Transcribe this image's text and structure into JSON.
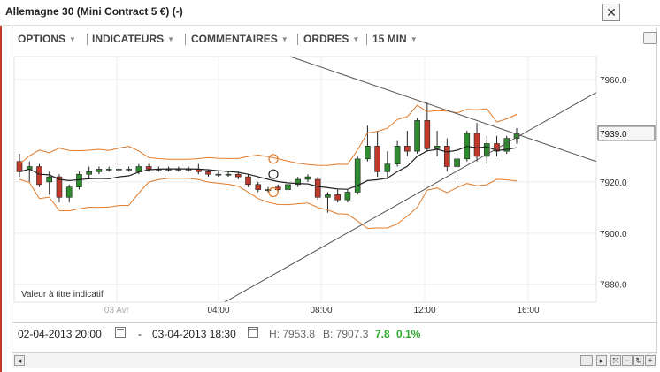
{
  "window": {
    "title": "Allemagne 30 (Mini Contract 5 €) (-)",
    "close_label": "✕"
  },
  "toolbar": {
    "items": [
      {
        "label": "OPTIONS"
      },
      {
        "label": "INDICATEURS"
      },
      {
        "label": "COMMENTAIRES"
      },
      {
        "label": "ORDRES"
      },
      {
        "label": "15 MIN"
      }
    ]
  },
  "chart": {
    "watermark": "Valeur à titre indicatif",
    "current_price_label": "7939.0"
  },
  "chart_data": {
    "type": "candlestick",
    "y_ticks": [
      "7960.0",
      "7920.0",
      "7900.0",
      "7880.0"
    ],
    "x_ticks": [
      "03 Avr",
      "04:00",
      "08:00",
      "12:00",
      "16:00"
    ],
    "ylim": [
      7870,
      7970
    ],
    "grid": true,
    "candles": [
      {
        "o": 7928,
        "h": 7931,
        "l": 7922,
        "c": 7924
      },
      {
        "o": 7925,
        "h": 7928,
        "l": 7920,
        "c": 7926
      },
      {
        "o": 7926,
        "h": 7927,
        "l": 7918,
        "c": 7919
      },
      {
        "o": 7920,
        "h": 7924,
        "l": 7915,
        "c": 7922
      },
      {
        "o": 7922,
        "h": 7923,
        "l": 7912,
        "c": 7914
      },
      {
        "o": 7914,
        "h": 7919,
        "l": 7912,
        "c": 7918
      },
      {
        "o": 7918,
        "h": 7924,
        "l": 7917,
        "c": 7923
      },
      {
        "o": 7923,
        "h": 7926,
        "l": 7921,
        "c": 7924
      },
      {
        "o": 7924,
        "h": 7926,
        "l": 7923,
        "c": 7925
      },
      {
        "o": 7925,
        "h": 7926,
        "l": 7924,
        "c": 7925
      },
      {
        "o": 7925,
        "h": 7926,
        "l": 7924,
        "c": 7925
      },
      {
        "o": 7925,
        "h": 7926,
        "l": 7924,
        "c": 7925
      },
      {
        "o": 7924,
        "h": 7927,
        "l": 7923,
        "c": 7926
      },
      {
        "o": 7926,
        "h": 7927,
        "l": 7924,
        "c": 7925
      },
      {
        "o": 7925,
        "h": 7926,
        "l": 7924,
        "c": 7925
      },
      {
        "o": 7925,
        "h": 7926,
        "l": 7924,
        "c": 7925
      },
      {
        "o": 7925,
        "h": 7926,
        "l": 7924,
        "c": 7925
      },
      {
        "o": 7925,
        "h": 7926,
        "l": 7924,
        "c": 7925
      },
      {
        "o": 7925,
        "h": 7927,
        "l": 7923,
        "c": 7924
      },
      {
        "o": 7924,
        "h": 7925,
        "l": 7922,
        "c": 7923
      },
      {
        "o": 7923,
        "h": 7924,
        "l": 7922,
        "c": 7923
      },
      {
        "o": 7923,
        "h": 7924,
        "l": 7922,
        "c": 7923
      },
      {
        "o": 7923,
        "h": 7924,
        "l": 7921,
        "c": 7922
      },
      {
        "o": 7922,
        "h": 7923,
        "l": 7918,
        "c": 7919
      },
      {
        "o": 7919,
        "h": 7920,
        "l": 7916,
        "c": 7917
      },
      {
        "o": 7917,
        "h": 7918,
        "l": 7916,
        "c": 7917
      },
      {
        "o": 7918,
        "h": 7919,
        "l": 7916,
        "c": 7917
      },
      {
        "o": 7917,
        "h": 7920,
        "l": 7916,
        "c": 7919
      },
      {
        "o": 7919,
        "h": 7922,
        "l": 7918,
        "c": 7921
      },
      {
        "o": 7921,
        "h": 7923,
        "l": 7920,
        "c": 7922
      },
      {
        "o": 7921,
        "h": 7922,
        "l": 7913,
        "c": 7914
      },
      {
        "o": 7914,
        "h": 7916,
        "l": 7908,
        "c": 7915
      },
      {
        "o": 7915,
        "h": 7917,
        "l": 7912,
        "c": 7913
      },
      {
        "o": 7913,
        "h": 7917,
        "l": 7912,
        "c": 7916
      },
      {
        "o": 7916,
        "h": 7930,
        "l": 7915,
        "c": 7929
      },
      {
        "o": 7929,
        "h": 7942,
        "l": 7928,
        "c": 7934
      },
      {
        "o": 7934,
        "h": 7940,
        "l": 7922,
        "c": 7924
      },
      {
        "o": 7924,
        "h": 7932,
        "l": 7921,
        "c": 7927
      },
      {
        "o": 7927,
        "h": 7936,
        "l": 7926,
        "c": 7934
      },
      {
        "o": 7934,
        "h": 7940,
        "l": 7930,
        "c": 7932
      },
      {
        "o": 7932,
        "h": 7945,
        "l": 7931,
        "c": 7944
      },
      {
        "o": 7944,
        "h": 7951,
        "l": 7932,
        "c": 7933
      },
      {
        "o": 7933,
        "h": 7940,
        "l": 7930,
        "c": 7934
      },
      {
        "o": 7934,
        "h": 7937,
        "l": 7924,
        "c": 7926
      },
      {
        "o": 7926,
        "h": 7931,
        "l": 7921,
        "c": 7929
      },
      {
        "o": 7929,
        "h": 7940,
        "l": 7928,
        "c": 7939
      },
      {
        "o": 7939,
        "h": 7943,
        "l": 7928,
        "c": 7930
      },
      {
        "o": 7930,
        "h": 7938,
        "l": 7927,
        "c": 7935
      },
      {
        "o": 7935,
        "h": 7938,
        "l": 7930,
        "c": 7932
      },
      {
        "o": 7932,
        "h": 7938,
        "l": 7931,
        "c": 7937
      },
      {
        "o": 7937,
        "h": 7941,
        "l": 7935,
        "c": 7939
      }
    ]
  },
  "footer": {
    "from_date": "02-04-2013 20:00",
    "dash": "-",
    "to_date": "03-04-2013 18:30",
    "high_label": "H: 7953.8",
    "low_label": "B: 7907.3",
    "change_value": "7.8",
    "change_pct": "0.1%",
    "change_color": "#2eaa2e"
  },
  "colors": {
    "bollinger": "#e07a2a",
    "ma": "#222222",
    "up_candle": "#2e8b2e",
    "down_candle": "#c0392b",
    "trend_lines": "#555555",
    "border_accent": "#c0392b"
  }
}
